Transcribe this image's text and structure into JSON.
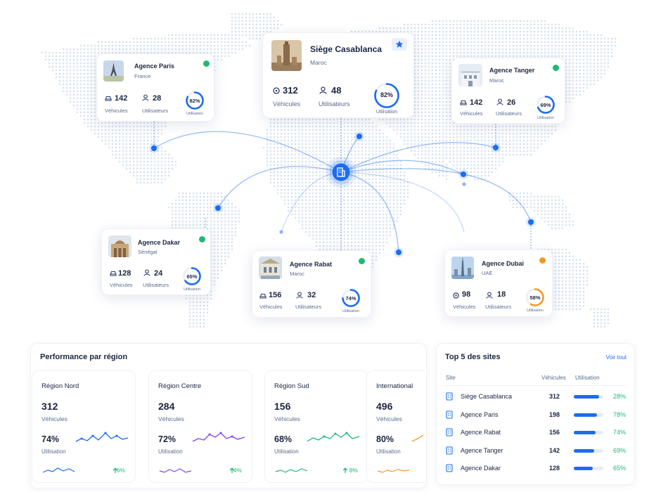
{
  "colors": {
    "accent": "#1a6cf2",
    "status_green": "#1fb876",
    "status_orange": "#f59a23",
    "text_dark": "#1b2540",
    "text_muted": "#5b6b8c"
  },
  "map": {
    "hub_icon": "building-icon",
    "sites": [
      {
        "name": "Agence Paris",
        "country": "France",
        "vehicles": "142",
        "vehicles_label": "Véhicules",
        "users": "28",
        "users_label": "Utilisateurs",
        "utilization": "82%",
        "utilization_value": 82,
        "utilization_label": "Utilisation",
        "status": "green",
        "thumb_icon": "eiffel-tower-icon"
      },
      {
        "name": "Siège Casablanca",
        "country": "Maroc",
        "vehicles": "312",
        "vehicles_label": "Véhicules",
        "users": "48",
        "users_label": "Utilisateurs",
        "utilization": "82%",
        "utilization_value": 82,
        "utilization_label": "Utilisation",
        "status": "star",
        "thumb_icon": "hassan-tower-icon"
      },
      {
        "name": "Agence Tanger",
        "country": "Maroc",
        "vehicles": "142",
        "vehicles_label": "Véhicules",
        "users": "26",
        "users_label": "Utilisateurs",
        "utilization": "69%",
        "utilization_value": 69,
        "utilization_label": "Utilisation",
        "status": "green",
        "thumb_icon": "building-icon"
      },
      {
        "name": "Agence Dakar",
        "country": "Sénégal",
        "vehicles": "128",
        "vehicles_label": "Véhicules",
        "users": "24",
        "users_label": "Utilisateurs",
        "utilization": "65%",
        "utilization_value": 65,
        "utilization_label": "Utilisation",
        "status": "green",
        "thumb_icon": "monument-icon"
      },
      {
        "name": "Agence Rabat",
        "country": "Maroc",
        "vehicles": "156",
        "vehicles_label": "Véhicules",
        "users": "32",
        "users_label": "Utilisateurs",
        "utilization": "74%",
        "utilization_value": 74,
        "utilization_label": "Utilisation",
        "status": "green",
        "thumb_icon": "building-icon"
      },
      {
        "name": "Agence Dubai",
        "country": "UAE",
        "vehicles": "98",
        "vehicles_label": "Véhicules",
        "users": "18",
        "users_label": "Utilisateurs",
        "utilization": "58%",
        "utilization_value": 58,
        "utilization_label": "Utilisation",
        "status": "orange",
        "thumb_icon": "skyscraper-icon"
      }
    ]
  },
  "performance": {
    "title": "Performance par région",
    "regions": [
      {
        "name": "Région Nord",
        "value": "312",
        "value_label": "Véhicules",
        "utilization": "74%",
        "utilization_label": "Utilisation",
        "delta": "6%",
        "color": "#1a6cf2"
      },
      {
        "name": "Région Centre",
        "value": "284",
        "value_label": "Véhicules",
        "utilization": "72%",
        "utilization_label": "Utilisation",
        "delta": "4%",
        "color": "#8a3ff0"
      },
      {
        "name": "Région Sud",
        "value": "156",
        "value_label": "Véhicules",
        "utilization": "68%",
        "utilization_label": "Utilisation",
        "delta": "8%",
        "color": "#1fb876"
      },
      {
        "name": "International",
        "value": "496",
        "value_label": "Véhicules",
        "utilization": "80%",
        "utilization_label": "Utilisation",
        "delta": "",
        "color": "#f59a23"
      }
    ]
  },
  "top_sites": {
    "title": "Top 5 des sites",
    "link": "Voir tout",
    "columns": {
      "site": "Site",
      "vehicles": "Véhicules",
      "utilization": "Utilisation"
    },
    "rows": [
      {
        "name": "Siège Casablanca",
        "vehicles": "312",
        "utilization": "28%",
        "utilization_value": 0.86
      },
      {
        "name": "Agence Paris",
        "vehicles": "198",
        "utilization": "78%",
        "utilization_value": 0.78
      },
      {
        "name": "Agence Rabat",
        "vehicles": "156",
        "utilization": "74%",
        "utilization_value": 0.74
      },
      {
        "name": "Agence Tanger",
        "vehicles": "142",
        "utilization": "69%",
        "utilization_value": 0.69
      },
      {
        "name": "Agence Dakar",
        "vehicles": "128",
        "utilization": "65%",
        "utilization_value": 0.65
      }
    ]
  }
}
